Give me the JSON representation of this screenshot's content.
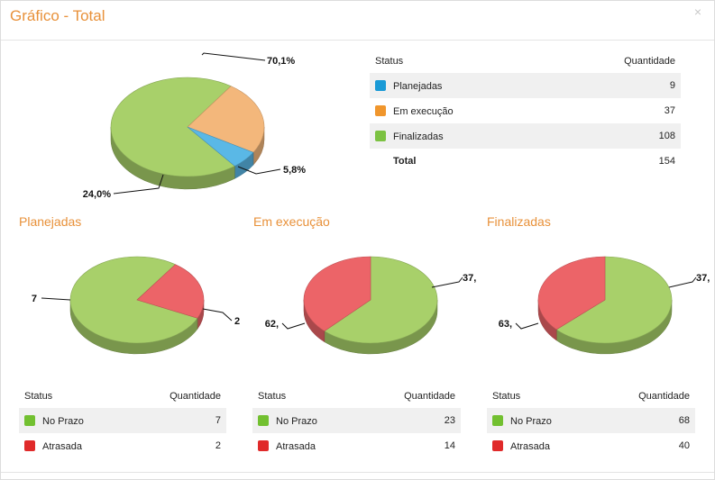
{
  "header": {
    "title": "Gráfico - Total",
    "close": "×"
  },
  "total": {
    "table": {
      "col_status": "Status",
      "col_qty": "Quantidade",
      "rows": [
        {
          "label": "Planejadas",
          "value": "9",
          "color": "#1a9ad6"
        },
        {
          "label": "Em execução",
          "value": "37",
          "color": "#f0962d"
        },
        {
          "label": "Finalizadas",
          "value": "108",
          "color": "#7cc242"
        }
      ],
      "total_label": "Total",
      "total_value": "154"
    }
  },
  "sections": [
    {
      "title": "Planejadas",
      "table": {
        "col_status": "Status",
        "col_qty": "Quantidade",
        "rows": [
          {
            "label": "No Prazo",
            "value": "7",
            "color": "#72c030"
          },
          {
            "label": "Atrasada",
            "value": "2",
            "color": "#e02a2a"
          }
        ]
      }
    },
    {
      "title": "Em execução",
      "table": {
        "col_status": "Status",
        "col_qty": "Quantidade",
        "rows": [
          {
            "label": "No Prazo",
            "value": "23",
            "color": "#72c030"
          },
          {
            "label": "Atrasada",
            "value": "14",
            "color": "#e02a2a"
          }
        ]
      }
    },
    {
      "title": "Finalizadas",
      "table": {
        "col_status": "Status",
        "col_qty": "Quantidade",
        "rows": [
          {
            "label": "No Prazo",
            "value": "68",
            "color": "#72c030"
          },
          {
            "label": "Atrasada",
            "value": "40",
            "color": "#e02a2a"
          }
        ]
      }
    }
  ],
  "chart_data": [
    {
      "type": "pie",
      "title": "",
      "categories": [
        "Finalizadas",
        "Em execução",
        "Planejadas"
      ],
      "values": [
        108,
        37,
        9
      ],
      "data_labels": [
        "70,1%",
        "24,0%",
        "5,8%"
      ],
      "colors": [
        "#a8d06a",
        "#f3b77b",
        "#5ab8e6"
      ]
    },
    {
      "type": "pie",
      "title": "Planejadas",
      "categories": [
        "No Prazo",
        "Atrasada"
      ],
      "values": [
        7,
        2
      ],
      "data_labels": [
        "7",
        "2"
      ],
      "colors": [
        "#a8d06a",
        "#ec6468"
      ]
    },
    {
      "type": "pie",
      "title": "Em execução",
      "categories": [
        "No Prazo",
        "Atrasada"
      ],
      "values": [
        23,
        14
      ],
      "data_labels": [
        "62,",
        "37,"
      ],
      "colors": [
        "#a8d06a",
        "#ec6468"
      ]
    },
    {
      "type": "pie",
      "title": "Finalizadas",
      "categories": [
        "No Prazo",
        "Atrasada"
      ],
      "values": [
        68,
        40
      ],
      "data_labels": [
        "63,",
        "37,"
      ],
      "colors": [
        "#a8d06a",
        "#ec6468"
      ]
    }
  ]
}
